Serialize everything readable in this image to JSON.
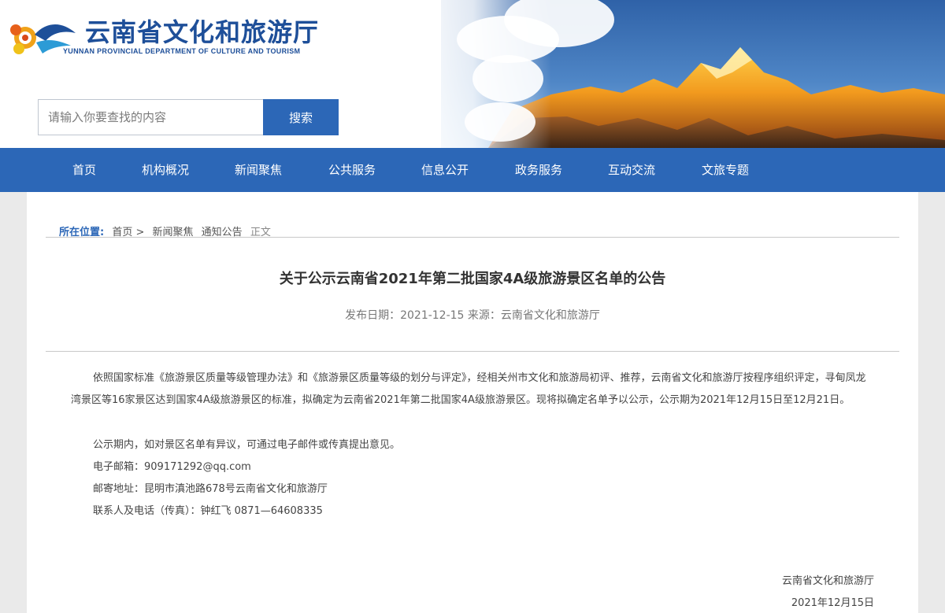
{
  "header": {
    "title": "云南省文化和旅游厅",
    "subtitle": "YUNNAN PROVINCIAL DEPARTMENT OF CULTURE AND TOURISM",
    "logo_icon": "auspicious-cloud-logo-icon",
    "banner_image": "golden-snow-mountain-banner"
  },
  "search": {
    "placeholder": "请输入你要查找的内容",
    "button_label": "搜索"
  },
  "nav": {
    "items": [
      {
        "label": "首页"
      },
      {
        "label": "机构概况"
      },
      {
        "label": "新闻聚焦"
      },
      {
        "label": "公共服务"
      },
      {
        "label": "信息公开"
      },
      {
        "label": "政务服务"
      },
      {
        "label": "互动交流"
      },
      {
        "label": "文旅专题"
      }
    ]
  },
  "breadcrumb": {
    "lead": "所在位置:",
    "items": [
      "首页 >",
      "新闻聚焦",
      "通知公告",
      "正文"
    ]
  },
  "article": {
    "title": "关于公示云南省2021年第二批国家4A级旅游景区名单的公告",
    "meta": "发布日期：2021-12-15 来源：云南省文化和旅游厅",
    "paragraph1": "依照国家标准《旅游景区质量等级管理办法》和《旅游景区质量等级的划分与评定》，经相关州市文化和旅游局初评、推荐，云南省文化和旅游厅按程序组织评定，寻甸凤龙湾景区等16家景区达到国家4A级旅游景区的标准，拟确定为云南省2021年第二批国家4A级旅游景区。现将拟确定名单予以公示，公示期为2021年12月15日至12月21日。",
    "paragraph2": "公示期内，如对景区名单有异议，可通过电子邮件或传真提出意见。",
    "email": "电子邮箱：909171292@qq.com",
    "address": "邮寄地址：昆明市滇池路678号云南省文化和旅游厅",
    "contact": "联系人及电话（传真）：钟红飞 0871—64608335",
    "sign_org": "云南省文化和旅游厅",
    "sign_date": "2021年12月15日"
  },
  "colors": {
    "brand_blue": "#2c67b7",
    "title_blue": "#1e4f99"
  }
}
